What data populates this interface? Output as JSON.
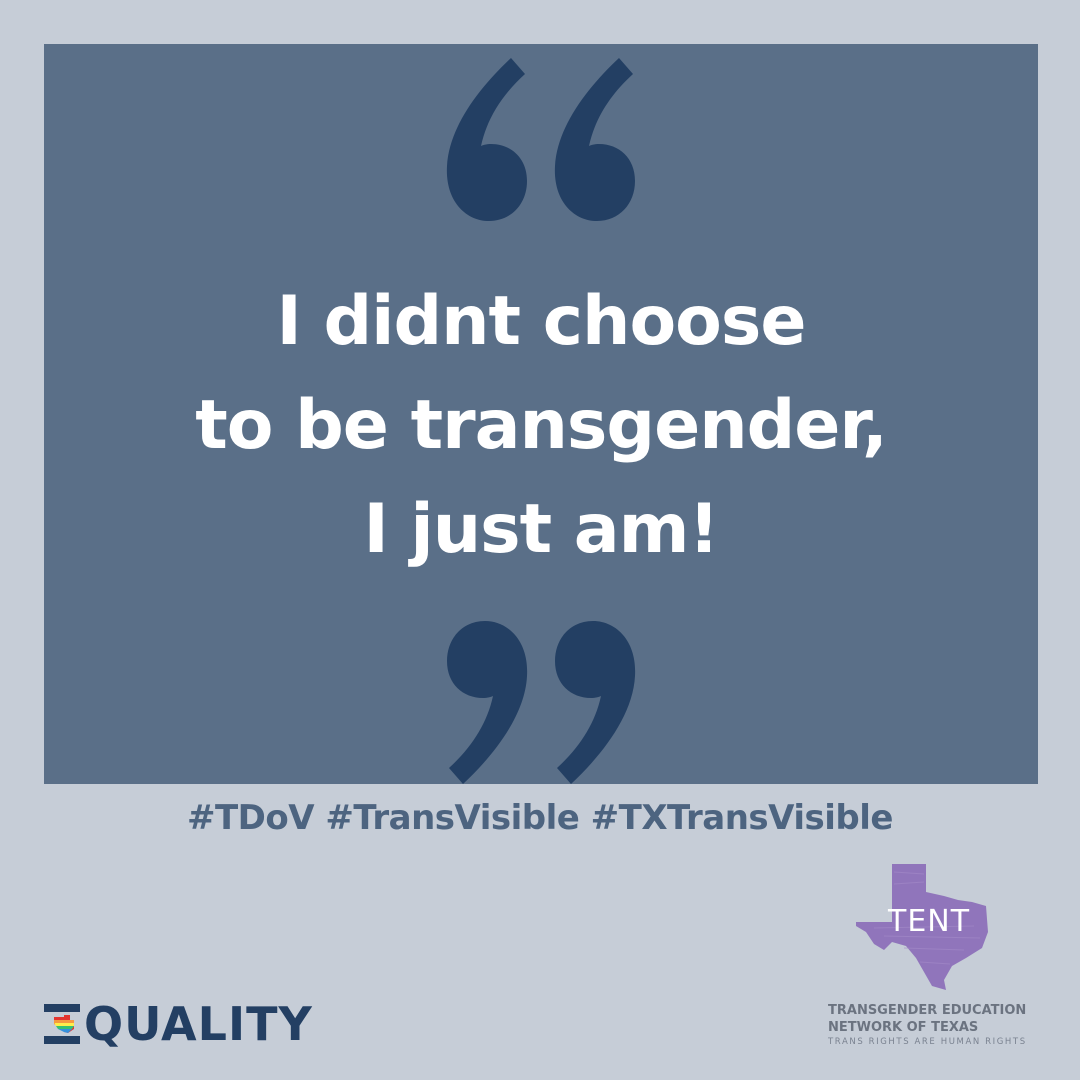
{
  "quote": {
    "lines": [
      "I didnt choose",
      "to be transgender,",
      "I just am!"
    ]
  },
  "hashtags": "#TDoV #TransVisible #TXTransVisible",
  "equality_logo": {
    "word": "QUALITY"
  },
  "tent_logo": {
    "acronym": "TENT",
    "name_lines": [
      "TRANSGENDER EDUCATION",
      "NETWORK OF TEXAS"
    ],
    "tagline": "TRANS RIGHTS ARE HUMAN RIGHTS"
  },
  "colors": {
    "background": "#c6cdd7",
    "panel": "#5a6f88",
    "quote_marks": "#233f63",
    "quote_text": "#ffffff",
    "hashtags": "#4d6480",
    "equality": "#233f63",
    "tent_purple": "#8a6bb8"
  },
  "icons": [
    "open-quote-icon",
    "close-quote-icon",
    "texas-rainbow-icon",
    "texas-map-icon"
  ]
}
